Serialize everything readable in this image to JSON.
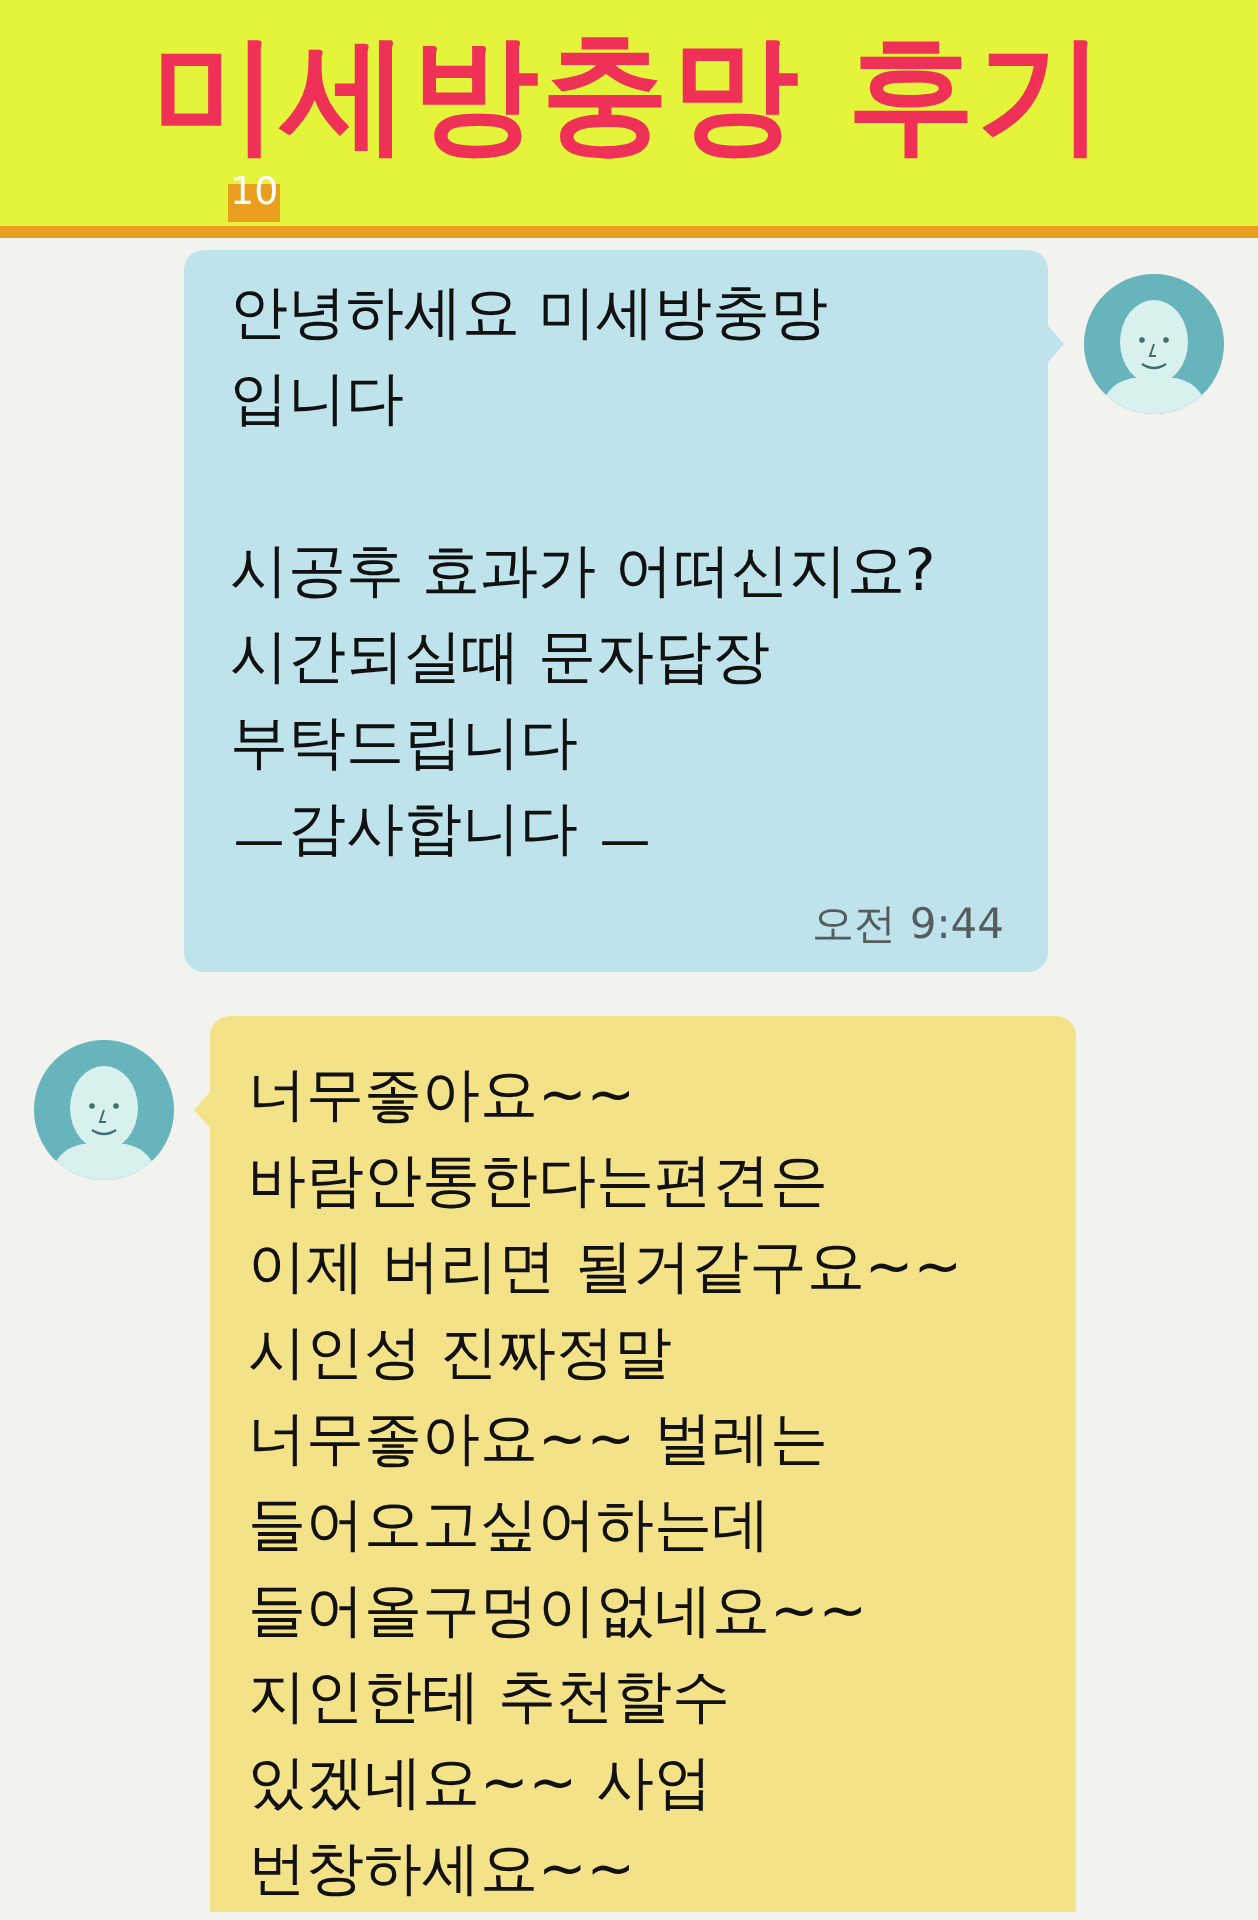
{
  "banner": {
    "title": "미세방충망 후기",
    "label": "10"
  },
  "messages": [
    {
      "kind": "outgoing",
      "text": "안녕하세요 미세방충망\n입니다\n\n시공후 효과가 어떠신지요?\n시간되실때 문자답장\n부탁드립니다\nㅡ감사합니다 ㅡ",
      "time": "오전 9:44"
    },
    {
      "kind": "incoming",
      "text": "너무좋아요~~\n바람안통한다는편견은\n이제 버리면 될거같구요~~\n시인성 진짜정말\n너무좋아요~~ 벌레는\n들어오고싶어하는데\n들어올구멍이없네요~~\n지인한테 추천할수\n있겠네요~~ 사업\n번창하세요~~"
    }
  ]
}
